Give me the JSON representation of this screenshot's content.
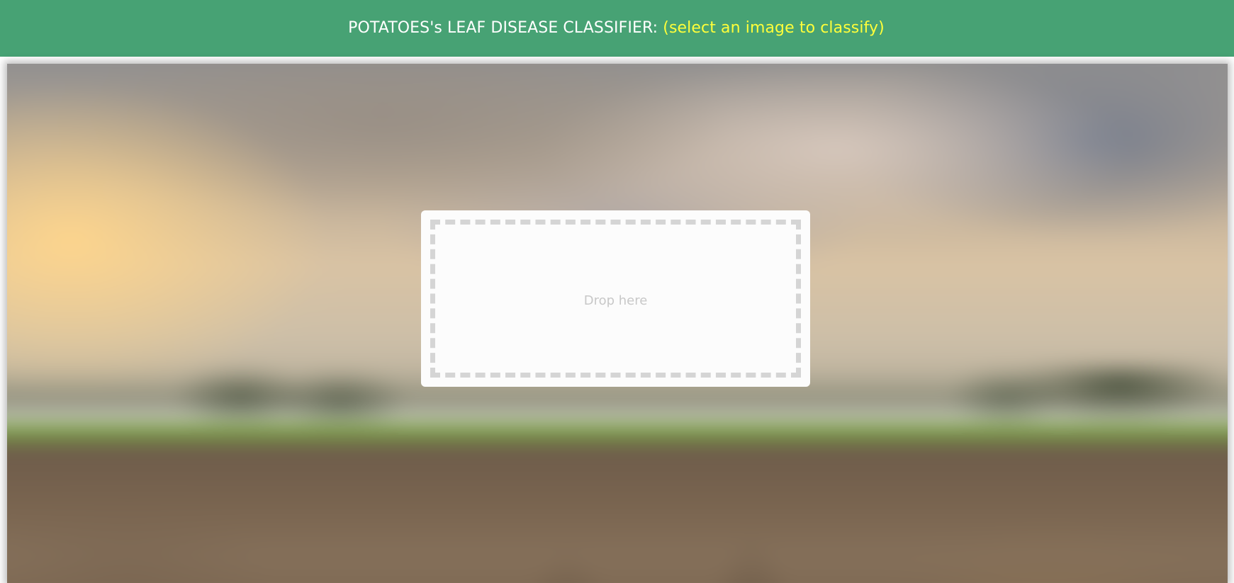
{
  "header": {
    "title": "POTATOES's LEAF DISEASE CLASSIFIER: ",
    "hint": "(select an image to classify)"
  },
  "dropzone": {
    "label": "Drop here"
  },
  "colors": {
    "header_bg": "#47a274",
    "header_text": "#ffffff",
    "hint_text": "#ffff3a",
    "dropzone_border": "#d5d5d5"
  }
}
